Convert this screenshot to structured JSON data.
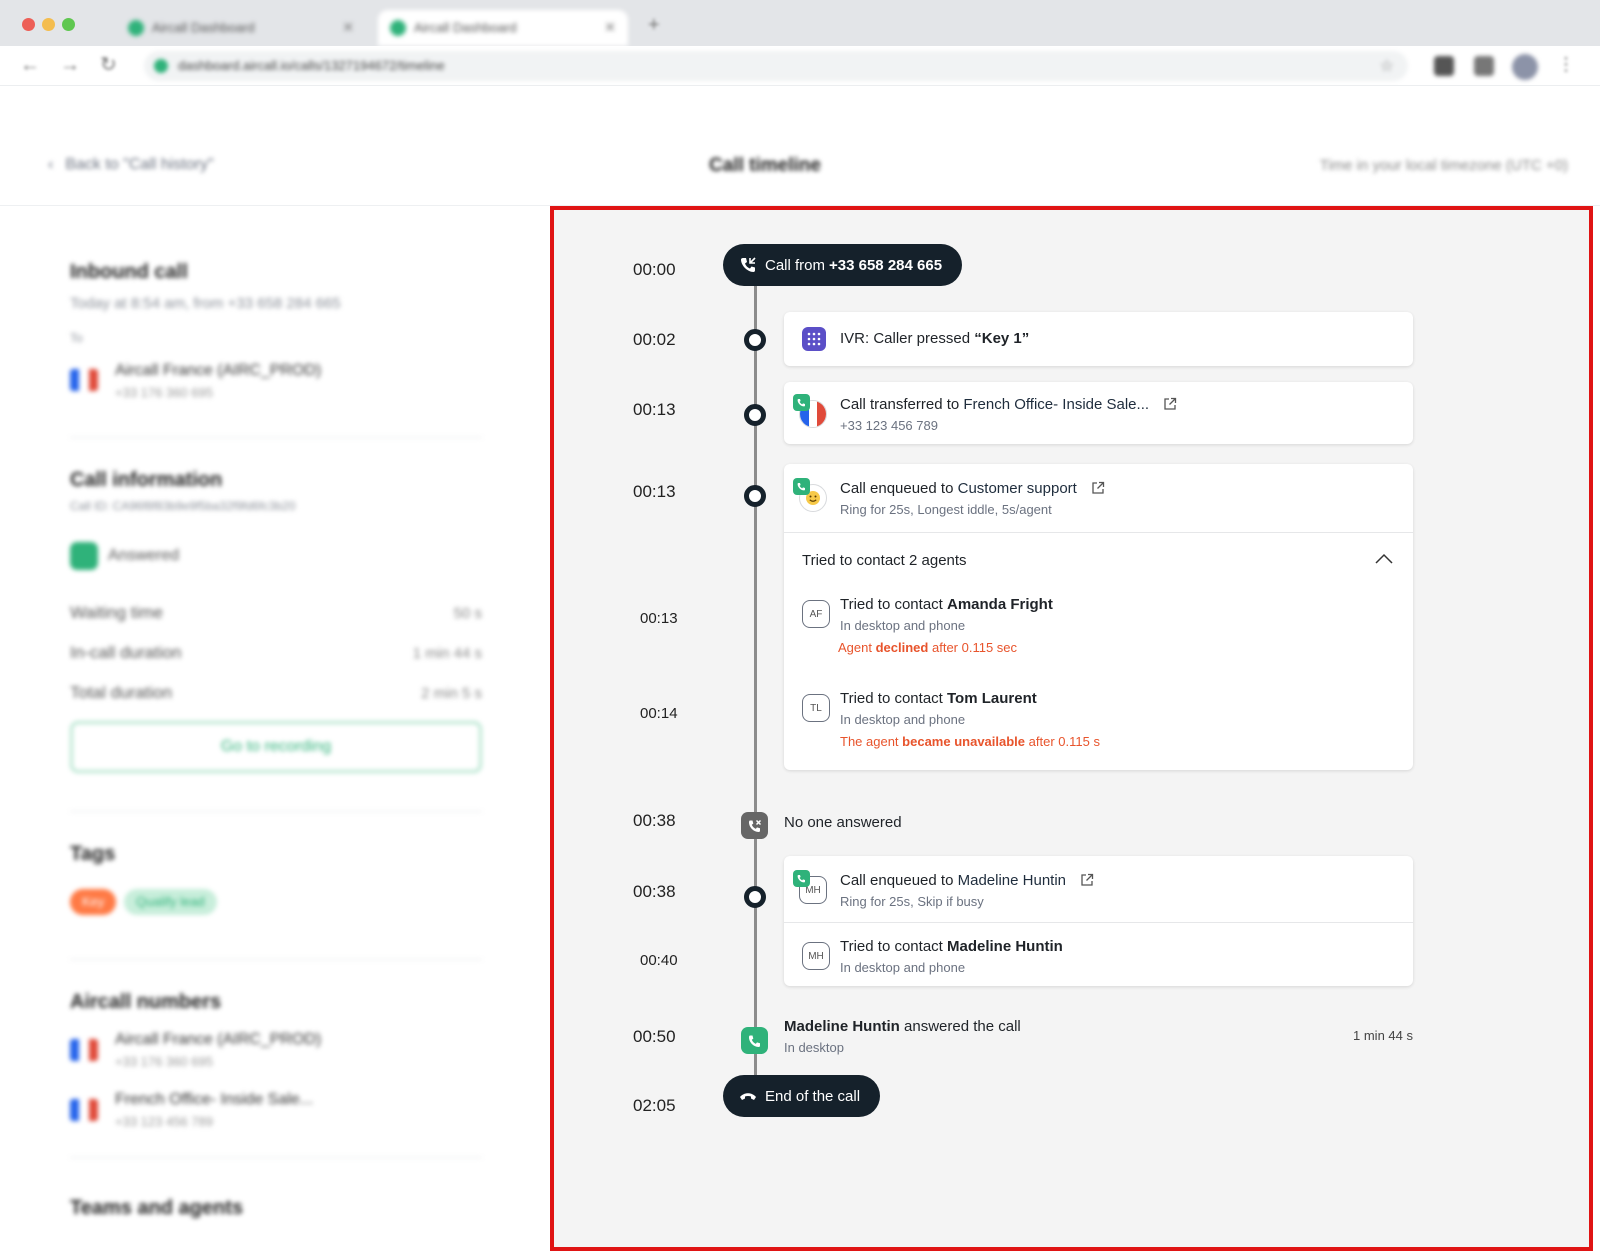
{
  "browser": {
    "tabs": [
      {
        "title": "Aircall Dashboard"
      },
      {
        "title": "Aircall Dashboard"
      }
    ],
    "url": "dashboard.aircall.io/calls/1327194672/timeline",
    "colors": {
      "close": "#ed5f57",
      "minimize": "#f4bd4f",
      "maximize": "#5fc750"
    }
  },
  "header": {
    "back_label": "Back to \"Call history\"",
    "title": "Call timeline",
    "timezone_note": "Time in your local timezone (UTC +0)"
  },
  "details": {
    "call_type": "Inbound call",
    "call_when": "Today at 8:54 am, from +33 658 284 665",
    "to_label": "To",
    "to_line": {
      "name": "Aircall France (AIRC_PROD)",
      "number": "+33 176 360 695"
    },
    "info_heading": "Call information",
    "call_id": "Call ID: CA96f8f83b9e9f5ba32f9fd6fc3b20",
    "status": "Answered",
    "rows": [
      {
        "label": "Waiting time",
        "value": "50 s"
      },
      {
        "label": "In-call duration",
        "value": "1 min 44 s"
      },
      {
        "label": "Total duration",
        "value": "2 min 5 s"
      }
    ],
    "recording_button": "Go to recording",
    "tags_heading": "Tags",
    "tags": [
      {
        "label": "Key",
        "color": "#ff7a45"
      },
      {
        "label": "Qualify lead",
        "color": "#c8eedb"
      }
    ],
    "numbers_heading": "Aircall numbers",
    "numbers": [
      {
        "name": "Aircall France (AIRC_PROD)",
        "number": "+33 176 360 695"
      },
      {
        "name": "French Office- Inside Sale...",
        "number": "+33 123 456 789"
      }
    ],
    "teams_heading": "Teams and agents"
  },
  "timeline": {
    "start": {
      "time": "00:00",
      "prefix": "Call from",
      "number": "+33 658 284 665"
    },
    "ivr": {
      "time": "00:02",
      "text_prefix": "IVR: Caller pressed",
      "key": "“Key 1”"
    },
    "transfer": {
      "time": "00:13",
      "prefix": "Call transferred to",
      "target": "French Office- Inside Sale...",
      "number": "+33 123 456 789"
    },
    "queue_support": {
      "time": "00:13",
      "prefix": "Call enqueued to",
      "target": "Customer support",
      "rules": "Ring for 25s, Longest iddle, 5s/agent",
      "tried_summary_prefix": "Tried to contact",
      "tried_summary_count": "2 agents",
      "agents": [
        {
          "time": "00:13",
          "initials": "AF",
          "prefix": "Tried to contact",
          "name": "Amanda Fright",
          "device": "In desktop and phone",
          "status_before": "Agent",
          "status_bold": "declined",
          "status_after": "after 0.115 sec"
        },
        {
          "time": "00:14",
          "initials": "TL",
          "prefix": "Tried to contact",
          "name": "Tom Laurent",
          "device": "In desktop and phone",
          "status_before": "The agent",
          "status_bold": "became unavailable",
          "status_after": "after 0.115 s"
        }
      ]
    },
    "no_answer": {
      "time": "00:38",
      "text": "No one answered"
    },
    "queue_agent": {
      "time": "00:38",
      "initials": "MH",
      "prefix": "Call enqueued to",
      "target": "Madeline Huntin",
      "rules": "Ring for 25s, Skip if busy",
      "attempt": {
        "time": "00:40",
        "initials": "MH",
        "prefix": "Tried to contact",
        "name": "Madeline Huntin",
        "device": "In desktop and phone"
      }
    },
    "answered": {
      "time": "00:50",
      "name": "Madeline Huntin",
      "suffix": "answered the call",
      "device": "In desktop",
      "duration": "1 min 44 s"
    },
    "end": {
      "time": "02:05",
      "text": "End of the call"
    }
  },
  "colors": {
    "highlight_border": "#e01414",
    "pill_bg": "#15212b",
    "ivr_purple": "#5b4fc7",
    "aircall_green": "#2fb27a",
    "warning_orange": "#e8542c",
    "flag_blue": "#2563eb",
    "flag_red": "#e04a3a"
  }
}
